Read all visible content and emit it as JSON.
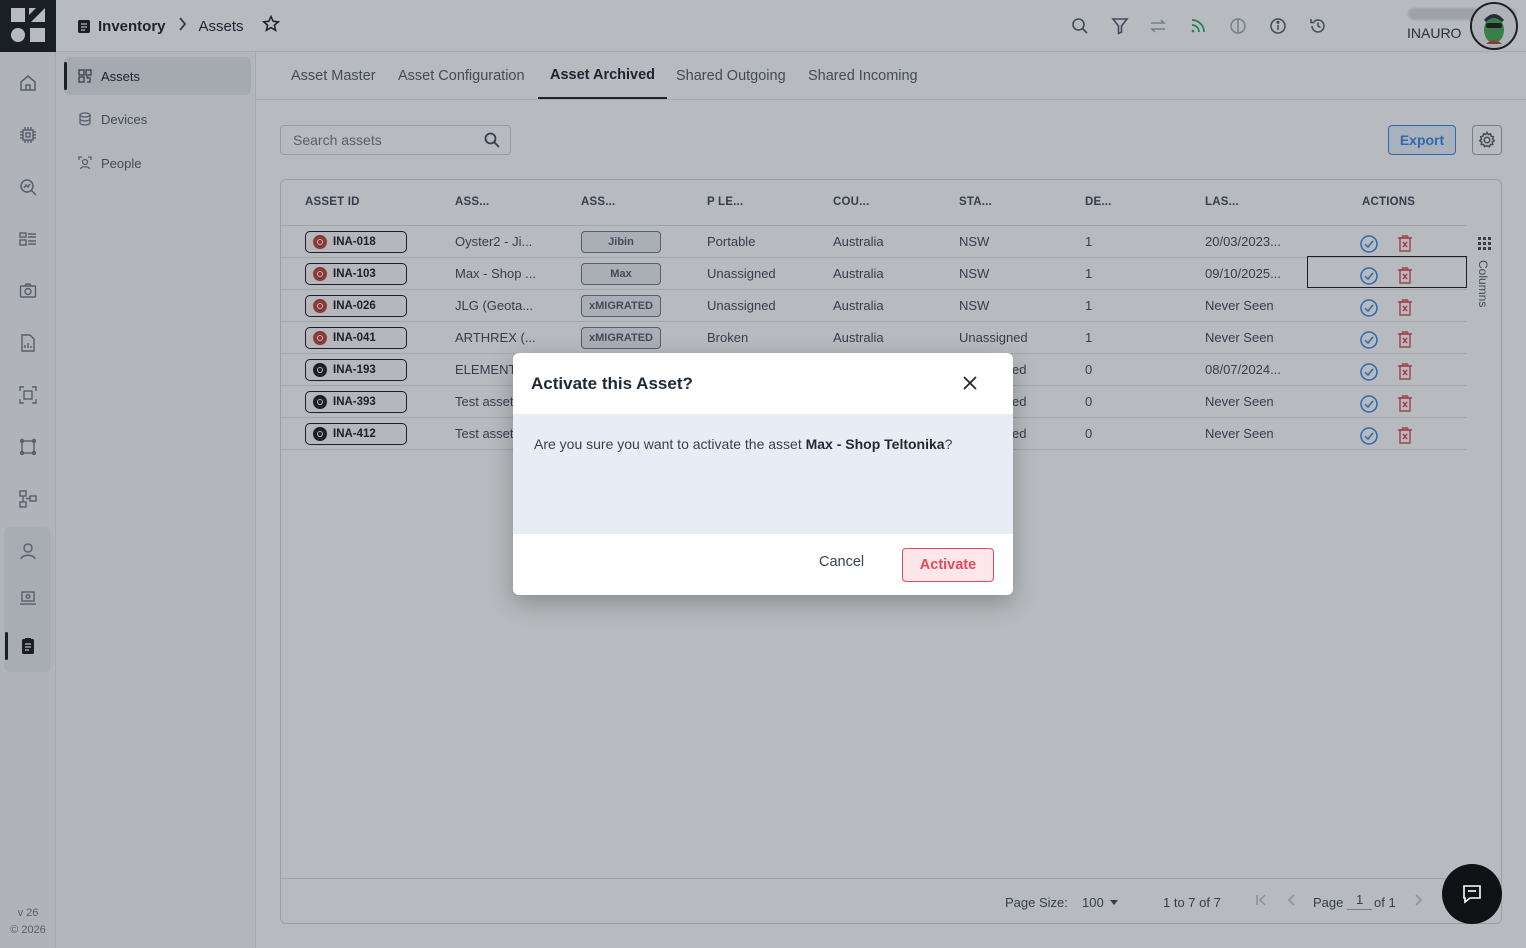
{
  "app": {
    "version": "v 26",
    "copyright": "© 2026"
  },
  "header": {
    "breadcrumb_root": "Inventory",
    "breadcrumb_current": "Assets",
    "user_name": "INAURO"
  },
  "sidebar": {
    "items": [
      {
        "label": "Assets",
        "icon": "qr-grid-icon",
        "active": true
      },
      {
        "label": "Devices",
        "icon": "database-icon",
        "active": false
      },
      {
        "label": "People",
        "icon": "people-icon",
        "active": false
      }
    ]
  },
  "tabs": [
    {
      "label": "Asset Master"
    },
    {
      "label": "Asset Configuration"
    },
    {
      "label": "Asset Archived"
    },
    {
      "label": "Shared Outgoing"
    },
    {
      "label": "Shared Incoming"
    }
  ],
  "toolbar": {
    "search_placeholder": "Search assets",
    "export_label": "Export"
  },
  "table": {
    "columns": [
      "ASSET ID",
      "ASS...",
      "ASS...",
      "P LE...",
      "COU...",
      "STA...",
      "DE...",
      "LAS...",
      "ACTIONS"
    ],
    "columns_panel_label": "Columns",
    "rows": [
      {
        "id": "INA-018",
        "dot_color": "#c0392b",
        "name": "Oyster2 - Ji...",
        "tag": "Jibin",
        "level": "Portable",
        "country": "Australia",
        "state": "NSW",
        "devices": "1",
        "last": "20/03/2023..."
      },
      {
        "id": "INA-103",
        "dot_color": "#c0392b",
        "name": "Max - Shop ...",
        "tag": "Max",
        "level": "Unassigned",
        "country": "Australia",
        "state": "NSW",
        "devices": "1",
        "last": "09/10/2025..."
      },
      {
        "id": "INA-026",
        "dot_color": "#c0392b",
        "name": "JLG (Geota...",
        "tag": "xMIGRATED",
        "level": "Unassigned",
        "country": "Australia",
        "state": "NSW",
        "devices": "1",
        "last": "Never Seen"
      },
      {
        "id": "INA-041",
        "dot_color": "#c0392b",
        "name": "ARTHREX (...",
        "tag": "xMIGRATED",
        "level": "Broken",
        "country": "Australia",
        "state": "Unassigned",
        "devices": "1",
        "last": "Never Seen"
      },
      {
        "id": "INA-193",
        "dot_color": "#111111",
        "name": "ELEMENT",
        "tag": "",
        "level": "",
        "country": "",
        "state": "ed",
        "devices": "0",
        "last": "08/07/2024..."
      },
      {
        "id": "INA-393",
        "dot_color": "#111111",
        "name": "Test asset",
        "tag": "",
        "level": "",
        "country": "",
        "state": "ed",
        "devices": "0",
        "last": "Never Seen"
      },
      {
        "id": "INA-412",
        "dot_color": "#111111",
        "name": "Test asset",
        "tag": "",
        "level": "",
        "country": "",
        "state": "ed",
        "devices": "0",
        "last": "Never Seen"
      }
    ]
  },
  "pagination": {
    "page_size_label": "Page Size:",
    "page_size": "100",
    "range": "1 to 7 of 7",
    "page_label": "Page",
    "page": "1",
    "of_label": "of 1"
  },
  "modal": {
    "title": "Activate this Asset?",
    "message_prefix": "Are you sure you want to activate the asset ",
    "asset_name": "Max - Shop Teltonika",
    "message_suffix": "?",
    "cancel_label": "Cancel",
    "confirm_label": "Activate"
  },
  "colors": {
    "accent_blue": "#2f80ed",
    "danger_red": "#e04b5a"
  }
}
